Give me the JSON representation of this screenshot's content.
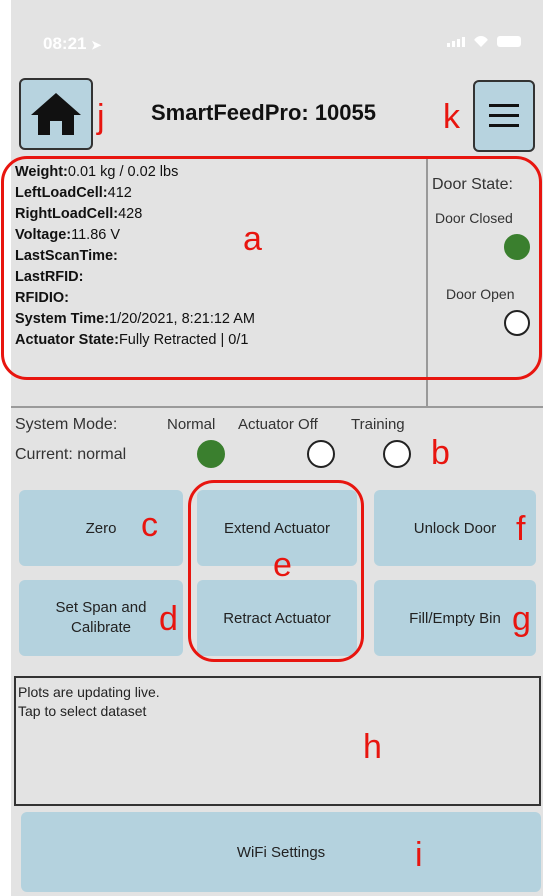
{
  "status_bar": {
    "time": "08:21"
  },
  "header": {
    "title": "SmartFeedPro: 10055"
  },
  "annotations": {
    "a": "a",
    "b": "b",
    "c": "c",
    "d": "d",
    "e": "e",
    "f": "f",
    "g": "g",
    "h": "h",
    "i": "i",
    "j": "j",
    "k": "k"
  },
  "info": {
    "rows": [
      {
        "label": "Weight:",
        "value": "0.01 kg / 0.02 lbs"
      },
      {
        "label": "LeftLoadCell:",
        "value": "412"
      },
      {
        "label": "RightLoadCell:",
        "value": "428"
      },
      {
        "label": "Voltage:",
        "value": "11.86 V"
      },
      {
        "label": "LastScanTime:",
        "value": ""
      },
      {
        "label": "LastRFID:",
        "value": ""
      },
      {
        "label": "RFIDIO:",
        "value": ""
      },
      {
        "label": "System Time:",
        "value": "1/20/2021, 8:21:12 AM"
      },
      {
        "label": "Actuator State:",
        "value": "Fully Retracted | 0/1"
      }
    ]
  },
  "door": {
    "title": "Door State:",
    "closed_label": "Door Closed",
    "open_label": "Door Open",
    "closed_active": true,
    "open_active": false
  },
  "mode": {
    "label": "System Mode:",
    "current": "Current: normal",
    "options": [
      {
        "label": "Normal",
        "active": true
      },
      {
        "label": "Actuator Off",
        "active": false
      },
      {
        "label": "Training",
        "active": false
      }
    ]
  },
  "buttons": {
    "zero": "Zero",
    "extend": "Extend Actuator",
    "unlock": "Unlock Door",
    "span": "Set Span and Calibrate",
    "retract": "Retract Actuator",
    "fill": "Fill/Empty Bin"
  },
  "plot": {
    "line1": "Plots are updating live.",
    "line2": "Tap to select dataset"
  },
  "wifi": {
    "label": "WiFi Settings"
  },
  "colors": {
    "button_bg": "#b4d2de",
    "active_green": "#3a7f2e",
    "annotation_red": "#e8150f",
    "background": "#e3e3e3"
  }
}
